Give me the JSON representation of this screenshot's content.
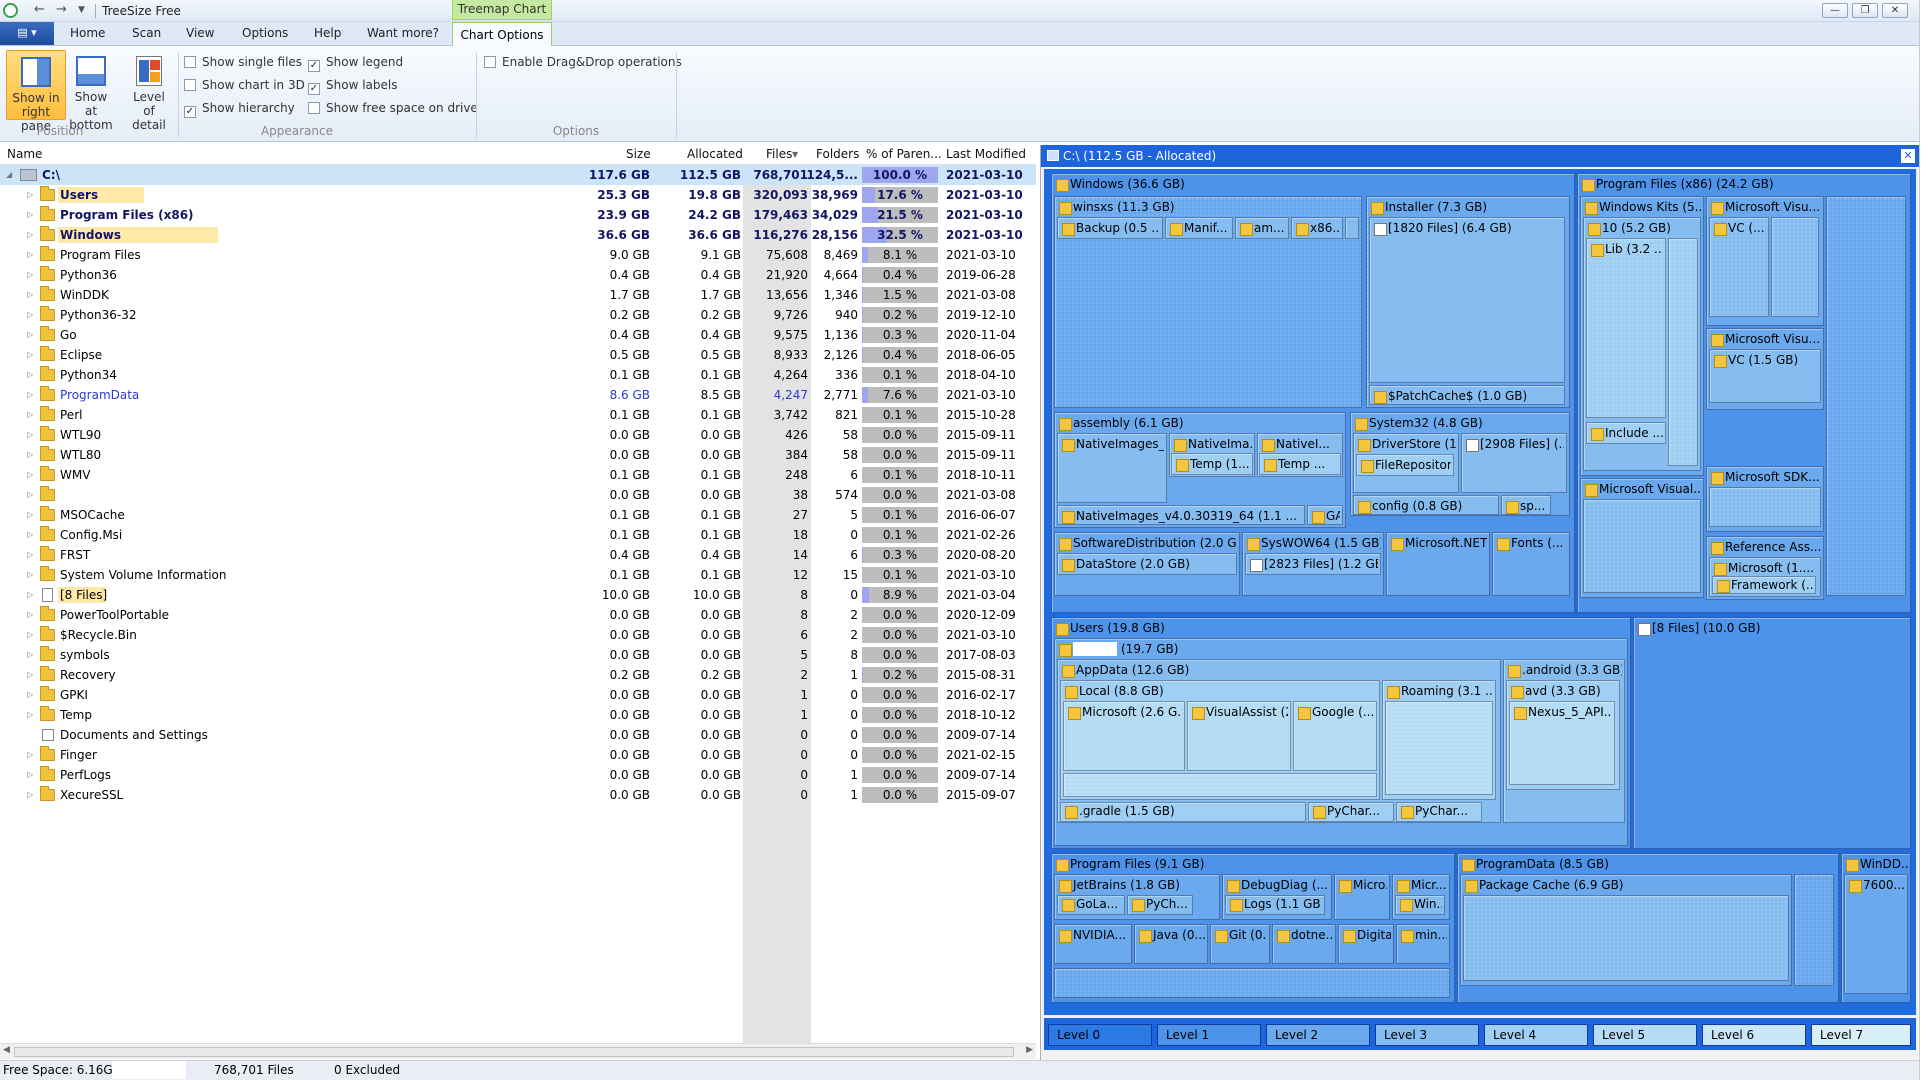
{
  "window": {
    "title": "TreeSize Free",
    "contextual_tab": "Treemap Chart"
  },
  "ribbon_tabs": [
    "Home",
    "Scan",
    "View",
    "Options",
    "Help",
    "Want more?",
    "Chart Options"
  ],
  "ribbon": {
    "btn_right_pane": [
      "Show in",
      "right pane"
    ],
    "btn_bottom": [
      "Show at",
      "bottom"
    ],
    "btn_level": [
      "Level of",
      "detail"
    ],
    "group_position": "Position",
    "group_appearance": "Appearance",
    "group_options": "Options",
    "checks": {
      "single_files": {
        "label": "Show single files",
        "checked": false
      },
      "chart_3d": {
        "label": "Show chart in 3D",
        "checked": false
      },
      "hierarchy": {
        "label": "Show hierarchy",
        "checked": true
      },
      "legend": {
        "label": "Show legend",
        "checked": true
      },
      "labels": {
        "label": "Show labels",
        "checked": true
      },
      "free_space": {
        "label": "Show free space on drive",
        "checked": false
      },
      "dragdrop": {
        "label": "Enable Drag&Drop operations",
        "checked": false
      }
    }
  },
  "columns": [
    "Name",
    "Size",
    "Allocated",
    "Files",
    "Folders",
    "% of Paren...",
    "Last Modified"
  ],
  "root": {
    "name": "C:\\",
    "size": "117.6 GB",
    "allocated": "112.5 GB",
    "files": "768,701",
    "folders": "124,5...",
    "pct": "100.0 %",
    "pct_value": 100,
    "modified": "2021-03-10"
  },
  "rows": [
    {
      "name": "Users",
      "size": "25.3 GB",
      "allocated": "19.8 GB",
      "files": "320,093",
      "folders": "38,969",
      "pct": "17.6 %",
      "pct_value": 17.6,
      "modified": "2021-03-10",
      "bold": true,
      "hl": 80
    },
    {
      "name": "Program Files (x86)",
      "size": "23.9 GB",
      "allocated": "24.2 GB",
      "files": "179,463",
      "folders": "34,029",
      "pct": "21.5 %",
      "pct_value": 21.5,
      "modified": "2021-03-10",
      "bold": true,
      "hl": 0
    },
    {
      "name": "Windows",
      "size": "36.6 GB",
      "allocated": "36.6 GB",
      "files": "116,276",
      "folders": "28,156",
      "pct": "32.5 %",
      "pct_value": 32.5,
      "modified": "2021-03-10",
      "bold": true,
      "hl": 160
    },
    {
      "name": "Program Files",
      "size": "9.0 GB",
      "allocated": "9.1 GB",
      "files": "75,608",
      "folders": "8,469",
      "pct": "8.1 %",
      "pct_value": 8.1,
      "modified": "2021-03-10"
    },
    {
      "name": "Python36",
      "size": "0.4 GB",
      "allocated": "0.4 GB",
      "files": "21,920",
      "folders": "4,664",
      "pct": "0.4 %",
      "pct_value": 0.4,
      "modified": "2019-06-28"
    },
    {
      "name": "WinDDK",
      "size": "1.7 GB",
      "allocated": "1.7 GB",
      "files": "13,656",
      "folders": "1,346",
      "pct": "1.5 %",
      "pct_value": 1.5,
      "modified": "2021-03-08"
    },
    {
      "name": "Python36-32",
      "size": "0.2 GB",
      "allocated": "0.2 GB",
      "files": "9,726",
      "folders": "940",
      "pct": "0.2 %",
      "pct_value": 0.2,
      "modified": "2019-12-10"
    },
    {
      "name": "Go",
      "size": "0.4 GB",
      "allocated": "0.4 GB",
      "files": "9,575",
      "folders": "1,136",
      "pct": "0.3 %",
      "pct_value": 0.3,
      "modified": "2020-11-04"
    },
    {
      "name": "Eclipse",
      "size": "0.5 GB",
      "allocated": "0.5 GB",
      "files": "8,933",
      "folders": "2,126",
      "pct": "0.4 %",
      "pct_value": 0.4,
      "modified": "2018-06-05"
    },
    {
      "name": "Python34",
      "size": "0.1 GB",
      "allocated": "0.1 GB",
      "files": "4,264",
      "folders": "336",
      "pct": "0.1 %",
      "pct_value": 0.1,
      "modified": "2018-04-10"
    },
    {
      "name": "ProgramData",
      "size": "8.6 GB",
      "allocated": "8.5 GB",
      "files": "4,247",
      "folders": "2,771",
      "pct": "7.6 %",
      "pct_value": 7.6,
      "modified": "2021-03-10",
      "blue": true
    },
    {
      "name": "Perl",
      "size": "0.1 GB",
      "allocated": "0.1 GB",
      "files": "3,742",
      "folders": "821",
      "pct": "0.1 %",
      "pct_value": 0.1,
      "modified": "2015-10-28"
    },
    {
      "name": "WTL90",
      "size": "0.0 GB",
      "allocated": "0.0 GB",
      "files": "426",
      "folders": "58",
      "pct": "0.0 %",
      "pct_value": 0,
      "modified": "2015-09-11"
    },
    {
      "name": "WTL80",
      "size": "0.0 GB",
      "allocated": "0.0 GB",
      "files": "384",
      "folders": "58",
      "pct": "0.0 %",
      "pct_value": 0,
      "modified": "2015-09-11"
    },
    {
      "name": "WMV",
      "size": "0.1 GB",
      "allocated": "0.1 GB",
      "files": "248",
      "folders": "6",
      "pct": "0.1 %",
      "pct_value": 0.1,
      "modified": "2018-10-11"
    },
    {
      "name": "",
      "size": "0.0 GB",
      "allocated": "0.0 GB",
      "files": "38",
      "folders": "574",
      "pct": "0.0 %",
      "pct_value": 0,
      "modified": "2021-03-08"
    },
    {
      "name": "MSOCache",
      "size": "0.1 GB",
      "allocated": "0.1 GB",
      "files": "27",
      "folders": "5",
      "pct": "0.1 %",
      "pct_value": 0.1,
      "modified": "2016-06-07"
    },
    {
      "name": "Config.Msi",
      "size": "0.1 GB",
      "allocated": "0.1 GB",
      "files": "18",
      "folders": "0",
      "pct": "0.1 %",
      "pct_value": 0.1,
      "modified": "2021-02-26"
    },
    {
      "name": "FRST",
      "size": "0.4 GB",
      "allocated": "0.4 GB",
      "files": "14",
      "folders": "6",
      "pct": "0.3 %",
      "pct_value": 0.3,
      "modified": "2020-08-20"
    },
    {
      "name": "System Volume Information",
      "size": "0.1 GB",
      "allocated": "0.1 GB",
      "files": "12",
      "folders": "15",
      "pct": "0.1 %",
      "pct_value": 0.1,
      "modified": "2021-03-10"
    },
    {
      "name": "[8 Files]",
      "size": "10.0 GB",
      "allocated": "10.0 GB",
      "files": "8",
      "folders": "0",
      "pct": "8.9 %",
      "pct_value": 8.9,
      "modified": "2021-03-04",
      "file": true,
      "hl": 48
    },
    {
      "name": "PowerToolPortable",
      "size": "0.0 GB",
      "allocated": "0.0 GB",
      "files": "8",
      "folders": "2",
      "pct": "0.0 %",
      "pct_value": 0,
      "modified": "2020-12-09"
    },
    {
      "name": "$Recycle.Bin",
      "size": "0.0 GB",
      "allocated": "0.0 GB",
      "files": "6",
      "folders": "2",
      "pct": "0.0 %",
      "pct_value": 0,
      "modified": "2021-03-10"
    },
    {
      "name": "symbols",
      "size": "0.0 GB",
      "allocated": "0.0 GB",
      "files": "5",
      "folders": "8",
      "pct": "0.0 %",
      "pct_value": 0,
      "modified": "2017-08-03"
    },
    {
      "name": "Recovery",
      "size": "0.2 GB",
      "allocated": "0.2 GB",
      "files": "2",
      "folders": "1",
      "pct": "0.2 %",
      "pct_value": 0.2,
      "modified": "2015-08-31"
    },
    {
      "name": "GPKI",
      "size": "0.0 GB",
      "allocated": "0.0 GB",
      "files": "1",
      "folders": "0",
      "pct": "0.0 %",
      "pct_value": 0,
      "modified": "2016-02-17"
    },
    {
      "name": "Temp",
      "size": "0.0 GB",
      "allocated": "0.0 GB",
      "files": "1",
      "folders": "0",
      "pct": "0.0 %",
      "pct_value": 0,
      "modified": "2018-10-12"
    },
    {
      "name": "Documents and Settings",
      "size": "0.0 GB",
      "allocated": "0.0 GB",
      "files": "0",
      "folders": "0",
      "pct": "0.0 %",
      "pct_value": 0,
      "modified": "2009-07-14",
      "link": true
    },
    {
      "name": "Finger",
      "size": "0.0 GB",
      "allocated": "0.0 GB",
      "files": "0",
      "folders": "0",
      "pct": "0.0 %",
      "pct_value": 0,
      "modified": "2021-02-15"
    },
    {
      "name": "PerfLogs",
      "size": "0.0 GB",
      "allocated": "0.0 GB",
      "files": "0",
      "folders": "1",
      "pct": "0.0 %",
      "pct_value": 0,
      "modified": "2009-07-14"
    },
    {
      "name": "XecureSSL",
      "size": "0.0 GB",
      "allocated": "0.0 GB",
      "files": "0",
      "folders": "1",
      "pct": "0.0 %",
      "pct_value": 0,
      "modified": "2015-09-07"
    }
  ],
  "status": {
    "free_space": "Free Space: 6.16GB",
    "files": "768,701 Files",
    "excluded": "0 Excluded"
  },
  "treemap": {
    "title": "C:\\ (112.5 GB - Allocated)",
    "labels": {
      "windows": "Windows (36.6 GB)",
      "winsxs": "winsxs (11.3 GB)",
      "backup": "Backup (0.5 ...",
      "manif": "Manif...",
      "am": "am...",
      "x86": "x86...",
      "installer": "Installer (7.3 GB)",
      "files1820": "[1820 Files] (6.4 GB)",
      "patchcache": "$PatchCache$ (1.0 GB)",
      "assembly": "assembly (6.1 GB)",
      "nativeimages": "NativeImages_...",
      "nativeima": "NativeIma...",
      "nativel": "NativeI...",
      "temp1": "Temp (1....",
      "temp2": "Temp ...",
      "nativeimages4": "NativeImages_v4.0.30319_64 (1.1 ...",
      "ga": "GA...",
      "system32": "System32 (4.8 GB)",
      "driverstore": "DriverStore (1...",
      "files2908": "[2908 Files] (...",
      "filerepo": "FileRepositor...",
      "config": "config (0.8 GB)",
      "sp": "sp...",
      "softdist": "SoftwareDistribution (2.0 GB)",
      "datastore": "DataStore (2.0 GB)",
      "syswow": "SysWOW64 (1.5 GB)",
      "files2823": "[2823 Files] (1.2 GB)",
      "mnet": "Microsoft.NET...",
      "fonts": "Fonts (...",
      "pfx86": "Program Files (x86) (24.2 GB)",
      "winkits": "Windows Kits (5...",
      "ten": "10 (5.2 GB)",
      "lib32": "Lib (3.2 ...",
      "include": "Include ...",
      "msvis1": "Microsoft Visu...",
      "vc1": "VC (...",
      "msvis2": "Microsoft Visu...",
      "vc15": "VC (1.5 GB)",
      "msvisual": "Microsoft Visual...",
      "mssdk": "Microsoft SDK...",
      "refass": "Reference Ass...",
      "ms1": "Microsoft (1....",
      "framework": "Framework (...",
      "users": "Users (19.8 GB)",
      "user197": "(19.7 GB)",
      "appdata": "AppData (12.6 GB)",
      "local": "Local (8.8 GB)",
      "ms26": "Microsoft (2.6 G...",
      "visualassist": "VisualAssist (2...",
      "google": "Google (...",
      "roaming": "Roaming (3.1 ...",
      "android": ".android (3.3 GB)",
      "avd": "avd (3.3 GB)",
      "nexus": "Nexus_5_API...",
      "gradle": ".gradle (1.5 GB)",
      "pychar1": "PyChar...",
      "pychar2": "PyChar...",
      "files8": "[8 Files] (10.0 GB)",
      "progfiles": "Program Files (9.1 GB)",
      "jetbrains": "JetBrains (1.8 GB)",
      "debugdiag": "DebugDiag (...",
      "micro": "Micro...",
      "micr": "Micr...",
      "gola": "GoLa...",
      "pych": "PyCh...",
      "logs": "Logs (1.1 GB)",
      "win": "Win...",
      "nvidia": "NVIDIA...",
      "java": "Java (0...",
      "git": "Git (0....",
      "dotne": "dotne...",
      "digita": "Digita...",
      "min": "min...",
      "progdata": "ProgramData (8.5 GB)",
      "pkgcache": "Package Cache (6.9 GB)",
      "windd": "WinDD...",
      "n7600": "7600...."
    },
    "levels": [
      "Level 0",
      "Level 1",
      "Level 2",
      "Level 3",
      "Level 4",
      "Level 5",
      "Level 6",
      "Level 7"
    ]
  }
}
